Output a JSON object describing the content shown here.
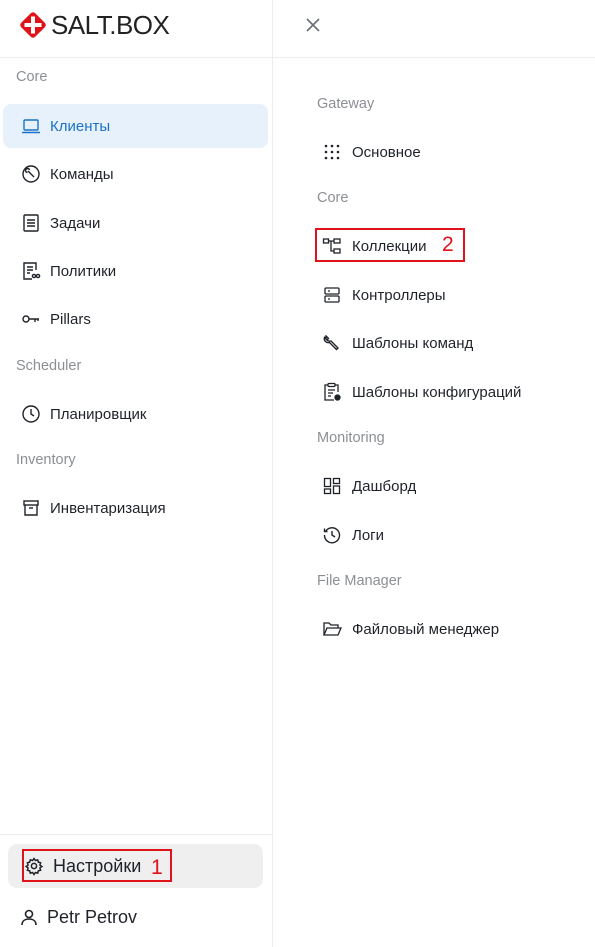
{
  "brand": {
    "name": "SALT.BOX",
    "accent": "#e0131a"
  },
  "sidebar": {
    "sections": [
      {
        "title": "Core"
      },
      {
        "title": "Scheduler"
      },
      {
        "title": "Inventory"
      }
    ],
    "items": [
      {
        "label": "Клиенты",
        "icon": "laptop-icon",
        "active": true
      },
      {
        "label": "Команды",
        "icon": "wrench-circle-icon"
      },
      {
        "label": "Задачи",
        "icon": "document-icon"
      },
      {
        "label": "Политики",
        "icon": "policy-icon"
      },
      {
        "label": "Pillars",
        "icon": "key-icon"
      },
      {
        "label": "Планировщик",
        "icon": "clock-icon"
      },
      {
        "label": "Инвентаризация",
        "icon": "archive-icon"
      }
    ],
    "settings_label": "Настройки",
    "user_name": "Petr Petrov"
  },
  "submenu": {
    "sections": [
      {
        "title": "Gateway"
      },
      {
        "title": "Core"
      },
      {
        "title": "Monitoring"
      },
      {
        "title": "File Manager"
      }
    ],
    "items": [
      {
        "label": "Основное",
        "icon": "grid-dots-icon"
      },
      {
        "label": "Коллекции",
        "icon": "collections-icon"
      },
      {
        "label": "Контроллеры",
        "icon": "server-icon"
      },
      {
        "label": "Шаблоны команд",
        "icon": "wrench-icon"
      },
      {
        "label": "Шаблоны конфигураций",
        "icon": "clipboard-config-icon"
      },
      {
        "label": "Дашборд",
        "icon": "dashboard-icon"
      },
      {
        "label": "Логи",
        "icon": "history-icon"
      },
      {
        "label": "Файловый менеджер",
        "icon": "folder-open-icon"
      }
    ]
  },
  "annotations": {
    "marker_1": "1",
    "marker_2": "2"
  }
}
